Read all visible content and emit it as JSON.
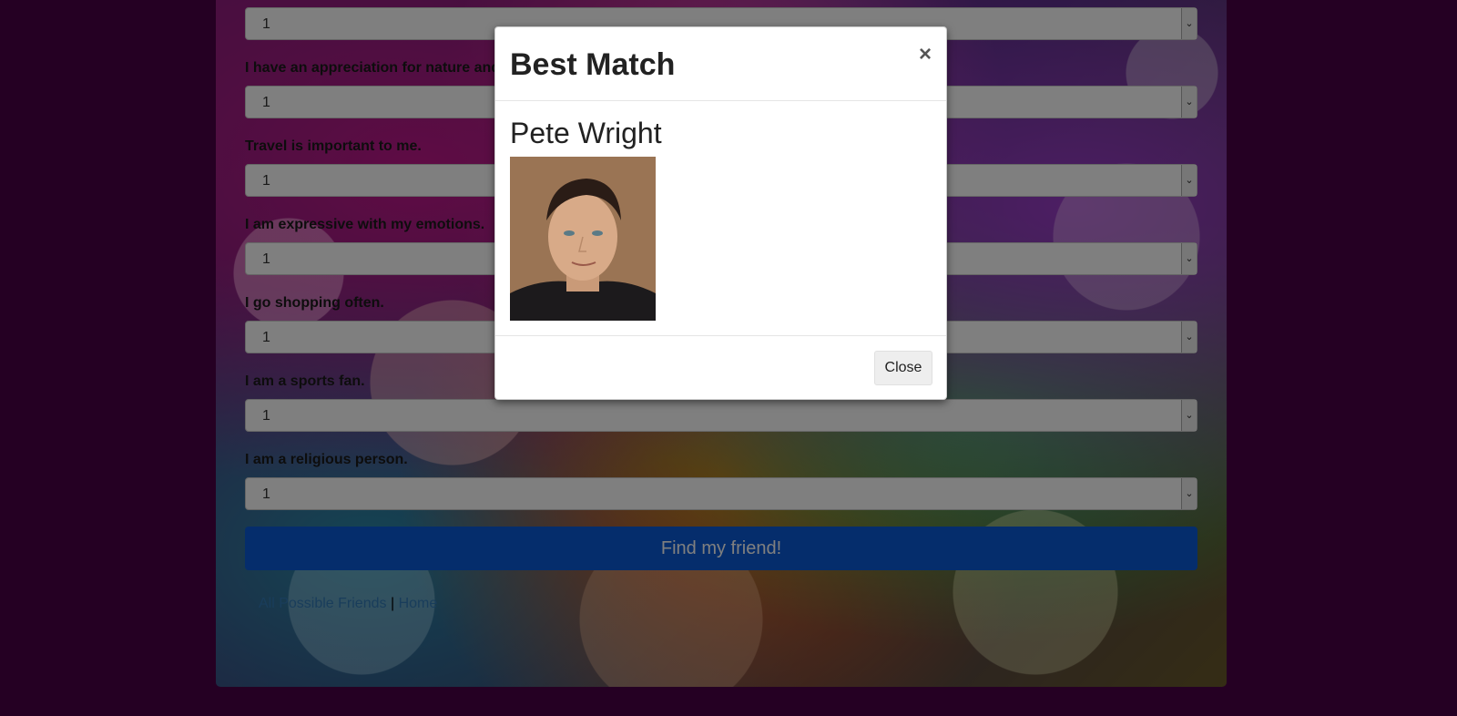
{
  "survey": {
    "questions": [
      {
        "label": "",
        "value": "1"
      },
      {
        "label": "I have an appreciation for nature and",
        "value": "1"
      },
      {
        "label": "Travel is important to me.",
        "value": "1"
      },
      {
        "label": "I am expressive with my emotions.",
        "value": "1"
      },
      {
        "label": "I go shopping often.",
        "value": "1"
      },
      {
        "label": "I am a sports fan.",
        "value": "1"
      },
      {
        "label": "I am a religious person.",
        "value": "1"
      }
    ],
    "submit_label": "Find my friend!",
    "links": {
      "all_friends": "All Possible Friends",
      "separator": "|",
      "home": "Home"
    }
  },
  "modal": {
    "title": "Best Match",
    "close_icon": "×",
    "match_name": "Pete Wright",
    "close_label": "Close"
  },
  "colors": {
    "page_bg": "#4a0047",
    "primary_button": "#0a5bd8"
  }
}
